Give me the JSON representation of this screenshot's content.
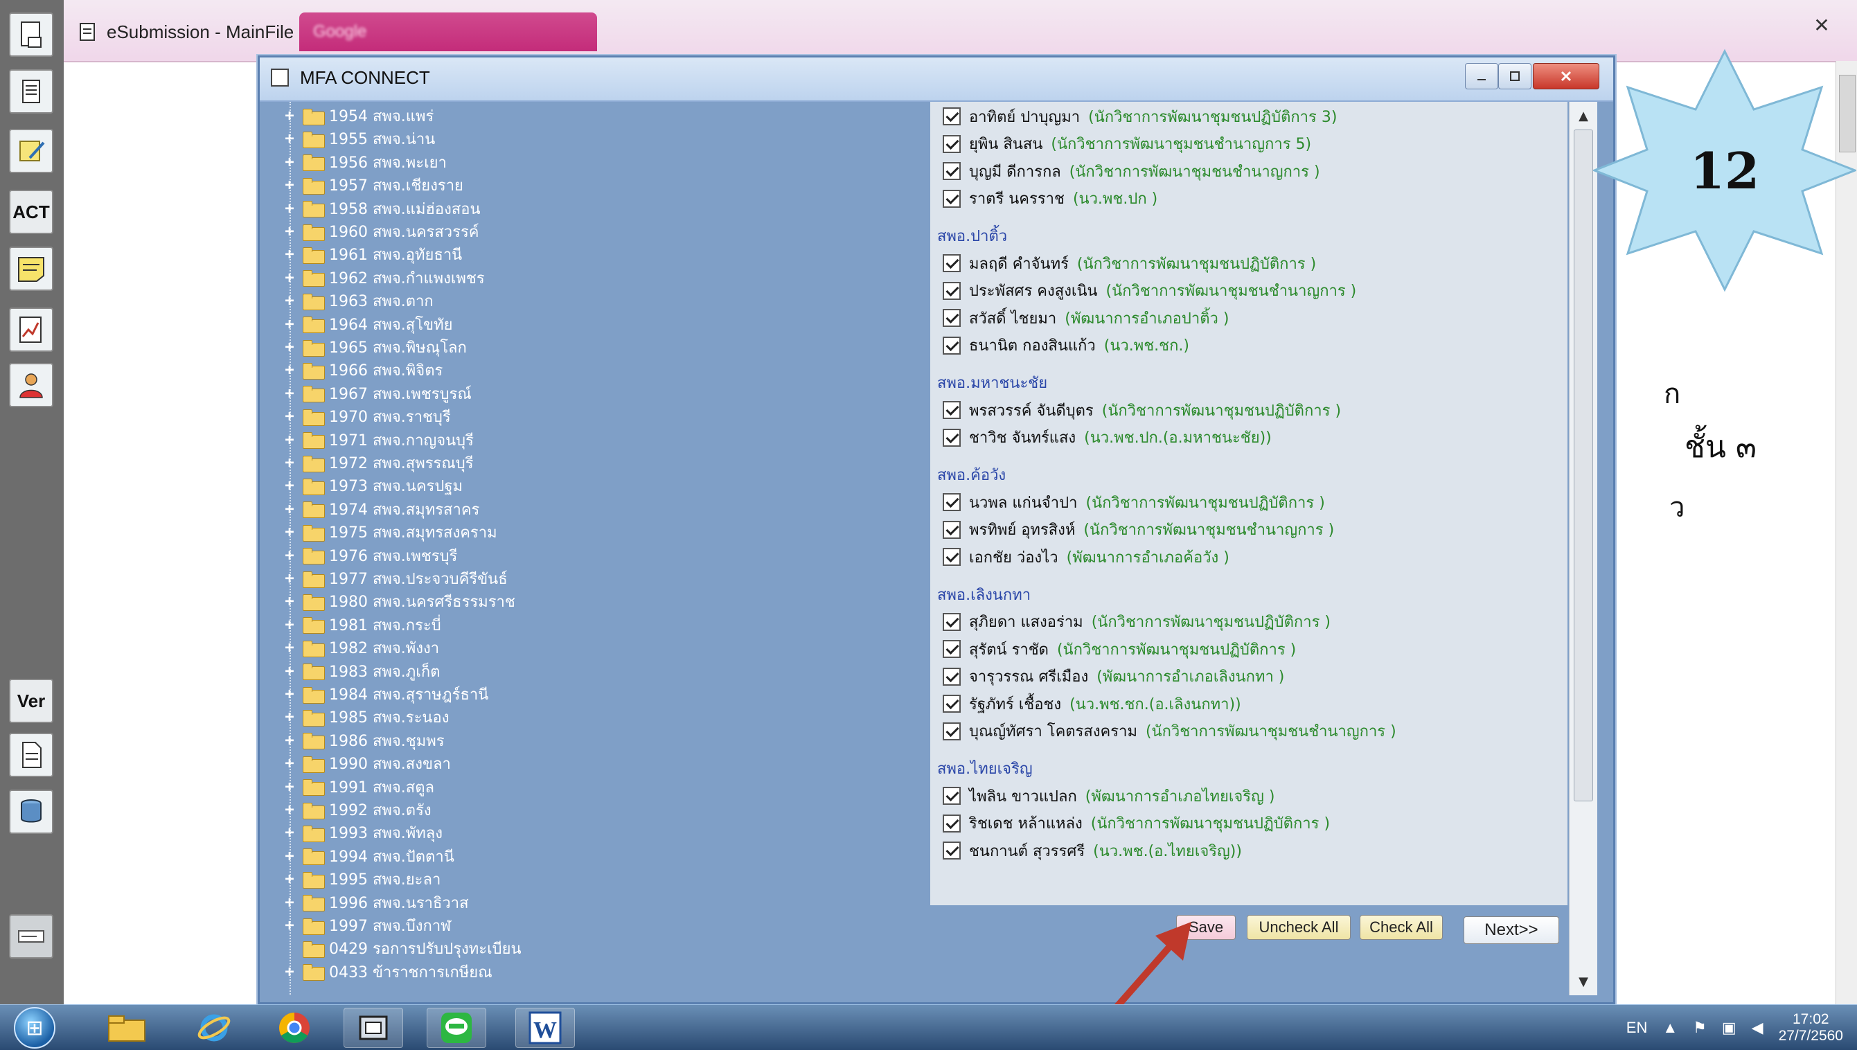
{
  "left_toolbar": {
    "act_label": "ACT",
    "ver_label": "Ver"
  },
  "browser": {
    "tab_title": "eSubmission - MainFile",
    "second_tab_title": "Google",
    "close_glyph": "✕",
    "bg_text_top": "ก",
    "bg_text_mid": "ชั้น ๓",
    "bg_text_bot": "ว"
  },
  "dialog": {
    "title": "MFA CONNECT",
    "tree_items": [
      {
        "label": "1954 สพจ.แพร่",
        "expand": "+"
      },
      {
        "label": "1955 สพจ.น่าน",
        "expand": "+"
      },
      {
        "label": "1956 สพจ.พะเยา",
        "expand": "+"
      },
      {
        "label": "1957 สพจ.เชียงราย",
        "expand": "+"
      },
      {
        "label": "1958 สพจ.แม่ฮ่องสอน",
        "expand": "+"
      },
      {
        "label": "1960 สพจ.นครสวรรค์",
        "expand": "+"
      },
      {
        "label": "1961 สพจ.อุทัยธานี",
        "expand": "+"
      },
      {
        "label": "1962 สพจ.กำแพงเพชร",
        "expand": "+"
      },
      {
        "label": "1963 สพจ.ตาก",
        "expand": "+"
      },
      {
        "label": "1964 สพจ.สุโขทัย",
        "expand": "+"
      },
      {
        "label": "1965 สพจ.พิษณุโลก",
        "expand": "+"
      },
      {
        "label": "1966 สพจ.พิจิตร",
        "expand": "+"
      },
      {
        "label": "1967 สพจ.เพชรบูรณ์",
        "expand": "+"
      },
      {
        "label": "1970 สพจ.ราชบุรี",
        "expand": "+"
      },
      {
        "label": "1971 สพจ.กาญจนบุรี",
        "expand": "+"
      },
      {
        "label": "1972 สพจ.สุพรรณบุรี",
        "expand": "+"
      },
      {
        "label": "1973 สพจ.นครปฐม",
        "expand": "+"
      },
      {
        "label": "1974 สพจ.สมุทรสาคร",
        "expand": "+"
      },
      {
        "label": "1975 สพจ.สมุทรสงคราม",
        "expand": "+"
      },
      {
        "label": "1976 สพจ.เพชรบุรี",
        "expand": "+"
      },
      {
        "label": "1977 สพจ.ประจวบคีรีขันธ์",
        "expand": "+"
      },
      {
        "label": "1980 สพจ.นครศรีธรรมราช",
        "expand": "+"
      },
      {
        "label": "1981 สพจ.กระบี่",
        "expand": "+"
      },
      {
        "label": "1982 สพจ.พังงา",
        "expand": "+"
      },
      {
        "label": "1983 สพจ.ภูเก็ต",
        "expand": "+"
      },
      {
        "label": "1984 สพจ.สุราษฎร์ธานี",
        "expand": "+"
      },
      {
        "label": "1985 สพจ.ระนอง",
        "expand": "+"
      },
      {
        "label": "1986 สพจ.ชุมพร",
        "expand": "+"
      },
      {
        "label": "1990 สพจ.สงขลา",
        "expand": "+"
      },
      {
        "label": "1991 สพจ.สตูล",
        "expand": "+"
      },
      {
        "label": "1992 สพจ.ตรัง",
        "expand": "+"
      },
      {
        "label": "1993 สพจ.พัทลุง",
        "expand": "+"
      },
      {
        "label": "1994 สพจ.ปัตตานี",
        "expand": "+"
      },
      {
        "label": "1995 สพจ.ยะลา",
        "expand": "+"
      },
      {
        "label": "1996 สพจ.นราธิวาส",
        "expand": "+"
      },
      {
        "label": "1997 สพจ.บึงกาฬ",
        "expand": "+"
      },
      {
        "label": "0429 รอการปรับปรุงทะเบียน",
        "expand": ""
      },
      {
        "label": "0433 ข้าราชการเกษียณ",
        "expand": "+"
      }
    ],
    "checklist": [
      {
        "kind": "row",
        "name": "อาทิตย์  ปาบุญมา",
        "pos": "(นักวิชาการพัฒนาชุมชนปฏิบัติการ  3)"
      },
      {
        "kind": "row",
        "name": "ยุพิน  สินสน",
        "pos": "(นักวิชาการพัฒนาชุมชนชำนาญการ  5)"
      },
      {
        "kind": "row",
        "name": "บุญมี  ดีการกล",
        "pos": "(นักวิชาการพัฒนาชุมชนชำนาญการ  )"
      },
      {
        "kind": "row",
        "name": "ราตรี  นครราช",
        "pos": "(นว.พช.ปก  )"
      },
      {
        "kind": "section",
        "name": "สพอ.ปาติ้ว"
      },
      {
        "kind": "row",
        "name": "มลฤดี  คำจันทร์",
        "pos": "(นักวิชาการพัฒนาชุมชนปฏิบัติการ  )"
      },
      {
        "kind": "row",
        "name": "ประพัสศร  คงสูงเนิน",
        "pos": "(นักวิชาการพัฒนาชุมชนชำนาญการ  )"
      },
      {
        "kind": "row",
        "name": "สวัสดิ์  ไชยมา",
        "pos": "(พัฒนาการอำเภอปาติ้ว  )"
      },
      {
        "kind": "row",
        "name": "ธนานิต  กองสินแก้ว",
        "pos": "(นว.พช.ชก.)"
      },
      {
        "kind": "section",
        "name": "สพอ.มหาชนะชัย"
      },
      {
        "kind": "row",
        "name": "พรสวรรค์  จันดีบุตร",
        "pos": "(นักวิชาการพัฒนาชุมชนปฏิบัติการ  )"
      },
      {
        "kind": "row",
        "name": "ชาวิช  จันทร์แสง",
        "pos": "(นว.พช.ปก.(อ.มหาชนะชัย))"
      },
      {
        "kind": "section",
        "name": "สพอ.ค้อวัง"
      },
      {
        "kind": "row",
        "name": "นวพล  แก่นจำปา",
        "pos": "(นักวิชาการพัฒนาชุมชนปฏิบัติการ  )"
      },
      {
        "kind": "row",
        "name": "พรทิพย์  อุทรสิงห์",
        "pos": "(นักวิชาการพัฒนาชุมชนชำนาญการ  )"
      },
      {
        "kind": "row",
        "name": "เอกชัย  ว่องไว",
        "pos": "(พัฒนาการอำเภอค้อวัง  )"
      },
      {
        "kind": "section",
        "name": "สพอ.เลิงนกทา"
      },
      {
        "kind": "row",
        "name": "สุภิยดา  แสงอร่าม",
        "pos": "(นักวิชาการพัฒนาชุมชนปฏิบัติการ  )"
      },
      {
        "kind": "row",
        "name": "สุรัตน์  ราชัด",
        "pos": "(นักวิชาการพัฒนาชุมชนปฏิบัติการ  )"
      },
      {
        "kind": "row",
        "name": "จารุวรรณ  ศรีเมือง",
        "pos": "(พัฒนาการอำเภอเลิงนกทา  )"
      },
      {
        "kind": "row",
        "name": "รัฐภัทร์  เชื้อชง",
        "pos": "(นว.พช.ชก.(อ.เลิงนกทา))"
      },
      {
        "kind": "row",
        "name": "บุณญ์ทัศรา  โคตรสงคราม",
        "pos": "(นักวิชาการพัฒนาชุมชนชำนาญการ  )"
      },
      {
        "kind": "section",
        "name": "สพอ.ไทยเจริญ"
      },
      {
        "kind": "row",
        "name": "ไพลิน  ขาวแปลก",
        "pos": "(พัฒนาการอำเภอไทยเจริญ  )"
      },
      {
        "kind": "row",
        "name": "ริชเดช  หล้าแหล่ง",
        "pos": "(นักวิชาการพัฒนาชุมชนปฏิบัติการ  )"
      },
      {
        "kind": "row",
        "name": "ชนกานต์  สุวรรศรี",
        "pos": "(นว.พช.(อ.ไทยเจริญ))"
      }
    ],
    "buttons": {
      "save": "Save",
      "uncheck_all": "Uncheck All",
      "check_all": "Check All",
      "next": "Next>>"
    }
  },
  "badge": {
    "number": "12"
  },
  "taskbar": {
    "lang": "EN",
    "time": "17:02",
    "date": "27/7/2560"
  },
  "colors": {
    "dialog_bg": "#7f9fc7",
    "list_bg": "#dde4ec",
    "section_text": "#2a46a8",
    "position_text": "#2c8a2c",
    "arrow": "#c0392b"
  }
}
